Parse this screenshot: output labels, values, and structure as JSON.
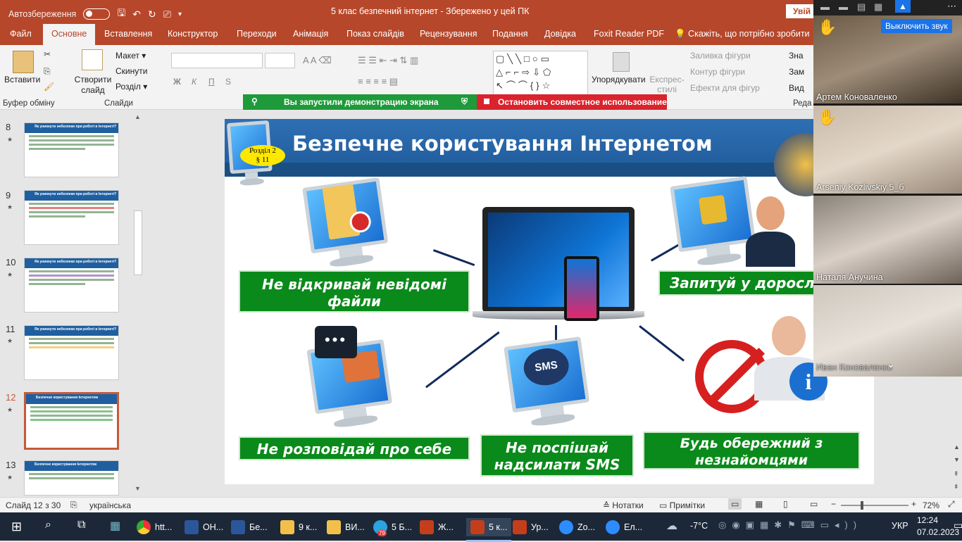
{
  "titlebar": {
    "autosave_label": "Автозбереження",
    "doc_title": "5 клас безпечний інтернет  -  Збережено у цей ПК",
    "share_label": "Увій"
  },
  "tabs": [
    "Файл",
    "Основне",
    "Вставлення",
    "Конструктор",
    "Переходи",
    "Анімація",
    "Показ слайдів",
    "Рецензування",
    "Подання",
    "Довідка",
    "Foxit Reader PDF",
    "Скажіть, що потрібно зробити"
  ],
  "ribbon": {
    "paste_label": "Вставити",
    "clipboard_group": "Буфер обміну",
    "new_slide_label": "Створити слайд",
    "layout_label": "Макет",
    "reset_label": "Скинути",
    "section_label": "Розділ",
    "slides_group": "Слайди",
    "bold": "Ж",
    "italic": "К",
    "underline": "П",
    "strike": "S",
    "arrange_label": "Упорядкувати",
    "quick_styles_label": "Експрес-стилі",
    "fill_label": "Заливка фігури",
    "outline_label": "Контур фігури",
    "effects_label": "Ефекти для фігур",
    "find_label": "Зна",
    "replace_label": "Зам",
    "select_label": "Вид",
    "editing_group": "Реда"
  },
  "sharing": {
    "status": "Вы запустили демонстрацию экрана",
    "stop": "Остановить совместное использование"
  },
  "thumbnails": [
    {
      "num": "8",
      "title": "Як уникнути небезпеки при роботі в Інтернеті?"
    },
    {
      "num": "9",
      "title": "Як уникнути небезпеки при роботі в Інтернеті?"
    },
    {
      "num": "10",
      "title": "Як уникнути небезпеки при роботі в Інтернеті?"
    },
    {
      "num": "11",
      "title": "Як уникнути небезпеки при роботі в Інтернеті?"
    },
    {
      "num": "12",
      "title": "Безпечне користування Інтернетом"
    },
    {
      "num": "13",
      "title": "Безпечне користування Інтернетом"
    }
  ],
  "slide": {
    "title": "Безпечне користування Інтернетом",
    "badge_line1": "Розділ 2",
    "badge_line2": "§ 11",
    "box1": "Не відкривай невідомі файли",
    "box2": "Запитуй у доросл",
    "box3": "Не розповідай про себе",
    "box4": "Не поспішай надсилати SMS",
    "box5": "Будь обережний з незнайомцями",
    "sms": "SMS"
  },
  "zoom": {
    "mute_label": "Выключить звук",
    "participants": [
      "Артем Коноваленко",
      "Arseniy Kozlivskiy 5_б",
      "Наталя Анучина",
      "Иван Коноваленко"
    ]
  },
  "status": {
    "slide_info": "Слайд 12 з 30",
    "language": "українська",
    "notes": "Нотатки",
    "comments": "Примітки",
    "zoom": "72%"
  },
  "taskbar": {
    "items": [
      "htt...",
      "ОН...",
      "Бе...",
      "9 к...",
      "ВИ...",
      "5 Б...",
      "Ж...",
      "5 к...",
      "Ур...",
      "Zo...",
      "Ел..."
    ],
    "telegram_badge": "79",
    "weather": "-7°C",
    "lang": "УКР",
    "time": "12:24",
    "date": "07.02.2023"
  },
  "colors": {
    "accent": "#b7472a",
    "slide_green": "#0a8a1a",
    "slide_blue": "#1f5a99"
  }
}
